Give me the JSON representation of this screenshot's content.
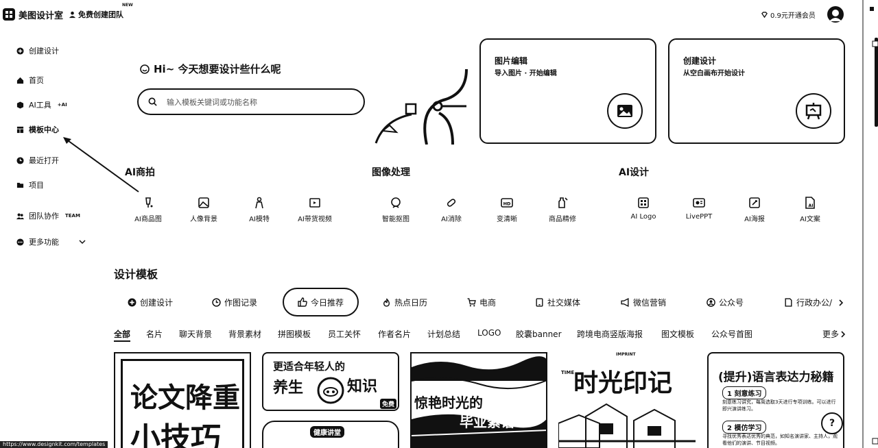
{
  "header": {
    "brand": "美图设计室",
    "team_link": "免费创建团队",
    "new_tag": "NEW",
    "vip": "0.9元开通会员"
  },
  "sidebar": {
    "items": [
      {
        "label": "创建设计",
        "icon": "plus-circle-icon"
      },
      {
        "label": "首页",
        "icon": "home-icon"
      },
      {
        "label": "AI工具",
        "tag": "+AI",
        "icon": "cube-icon"
      },
      {
        "label": "模板中心",
        "icon": "template-icon"
      },
      {
        "label": "最近打开",
        "icon": "clock-icon"
      },
      {
        "label": "项目",
        "icon": "folder-icon"
      },
      {
        "label": "团队协作",
        "tag": "TEAM",
        "icon": "team-icon"
      },
      {
        "label": "更多功能",
        "icon": "grid-icon"
      }
    ]
  },
  "hero": {
    "greeting": "Hi~ 今天想要设计些什么呢",
    "search_placeholder": "输入模板关键词或功能名称",
    "cards": [
      {
        "title": "图片编辑",
        "subtitle": "导入图片 · 开始编辑",
        "icon": "image-icon"
      },
      {
        "title": "创建设计",
        "subtitle": "从空白画布开始设计",
        "icon": "canvas-icon"
      }
    ]
  },
  "tool_groups": [
    {
      "title": "AI商拍",
      "tools": [
        "AI商品图",
        "人像背景",
        "AI模特",
        "AI带货视频"
      ]
    },
    {
      "title": "图像处理",
      "tools": [
        "智能抠图",
        "AI消除",
        "变清晰",
        "商品精修"
      ]
    },
    {
      "title": "AI设计",
      "tools": [
        "AI Logo",
        "LivePPT",
        "AI海报",
        "AI文案"
      ]
    }
  ],
  "templates": {
    "title": "设计模板",
    "tabs": [
      "创建设计",
      "作图记录",
      "今日推荐",
      "热点日历",
      "电商",
      "社交媒体",
      "微信营销",
      "公众号",
      "行政办公/"
    ],
    "active_tab": "今日推荐",
    "categories": [
      "全部",
      "名片",
      "聊天背景",
      "背景素材",
      "拼图模板",
      "员工关怀",
      "作者名片",
      "计划总结",
      "LOGO",
      "胶囊banner",
      "跨境电商竖版海报",
      "图文模板",
      "公众号首图"
    ],
    "more": "更多",
    "thumbs": {
      "t1_line1": "论文降重",
      "t1_line2": "小技巧",
      "t2_line1": "更适合年轻人的",
      "t2_line2": "养生",
      "t2_line3": "知识",
      "t2_badge": "免费",
      "t2_sub": "健康讲堂",
      "t3_line1": "惊艳时光的",
      "t3_line2": "毕业絮语",
      "t4_line1": "时光印记",
      "t4_small": "IMPRINT",
      "t4_tiny": "TIME",
      "t5_title": "(提升)语言表达力秘籍",
      "t5_item1": "1 刻意练习",
      "t5_item1_text": "刻意练习讲究，每周选取3天进行专项训练。可以进行即兴演讲练习。",
      "t5_item2": "2 模仿学习",
      "t5_item2_text": "寻找优秀表达优秀的典范，如知名演讲家、主持人，观看他们的演讲、节目视频。"
    }
  },
  "status_url": "https://www.designkit.com/templates",
  "help": "?"
}
